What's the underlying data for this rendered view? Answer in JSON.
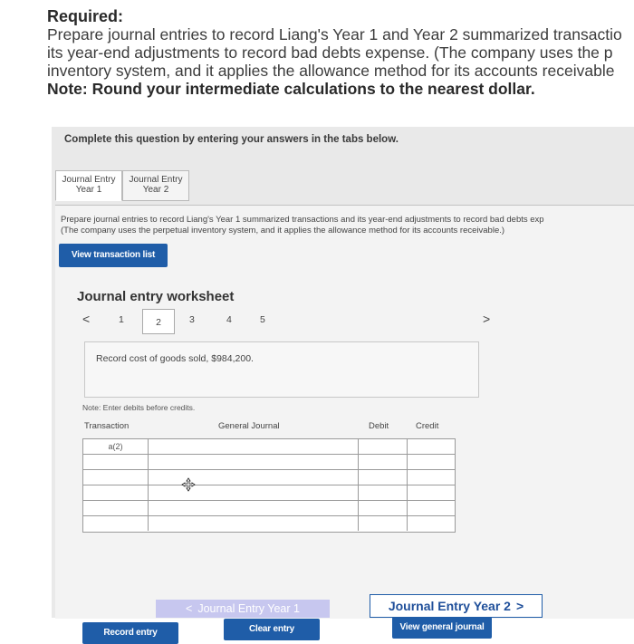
{
  "required": {
    "heading": "Required:",
    "line1": "Prepare journal entries to record Liang's Year 1 and Year 2 summarized transactio",
    "line2": "its year-end adjustments to record bad debts expense. (The company uses the p",
    "line3": "inventory system, and it applies the allowance method for its accounts receivable",
    "note": "Note: Round your intermediate calculations to the nearest dollar."
  },
  "panel": {
    "heading": "Complete this question by entering your answers in the tabs below."
  },
  "tabs": [
    {
      "line1": "Journal Entry",
      "line2": "Year 1"
    },
    {
      "line1": "Journal Entry",
      "line2": "Year 2"
    }
  ],
  "instructions": {
    "line1": "Prepare journal entries to record Liang's Year 1 summarized transactions and its year-end adjustments to record bad debts exp",
    "line2": "(The company uses the perpetual inventory system, and it applies the allowance method for its accounts receivable.)"
  },
  "buttons": {
    "view_transactions": "View transaction list",
    "record_entry": "Record entry",
    "clear_entry": "Clear entry",
    "view_general_journal": "View general journal"
  },
  "worksheet": {
    "title": "Journal entry worksheet",
    "pages": [
      "1",
      "2",
      "3",
      "4",
      "5"
    ],
    "current_page": "2",
    "prev_arrow": "<",
    "next_arrow": ">",
    "record_text": "Record cost of goods sold, $984,200.",
    "note": "Note: Enter debits before credits.",
    "columns": {
      "transaction": "Transaction",
      "general_journal": "General Journal",
      "debit": "Debit",
      "credit": "Credit"
    },
    "rows": [
      {
        "transaction": "a(2)",
        "account": "",
        "debit": "",
        "credit": ""
      },
      {
        "transaction": "",
        "account": "",
        "debit": "",
        "credit": ""
      },
      {
        "transaction": "",
        "account": "",
        "debit": "",
        "credit": ""
      },
      {
        "transaction": "",
        "account": "",
        "debit": "",
        "credit": ""
      },
      {
        "transaction": "",
        "account": "",
        "debit": "",
        "credit": ""
      },
      {
        "transaction": "",
        "account": "",
        "debit": "",
        "credit": ""
      }
    ]
  },
  "nav": {
    "prev": "Journal Entry Year 1",
    "next": "Journal Entry Year 2",
    "prev_arrow": "<",
    "next_arrow": ">"
  },
  "colors": {
    "accent": "#1f5da8",
    "panel_bg": "#e9e9e9",
    "nav_prev_bg": "#c7c7ef"
  }
}
